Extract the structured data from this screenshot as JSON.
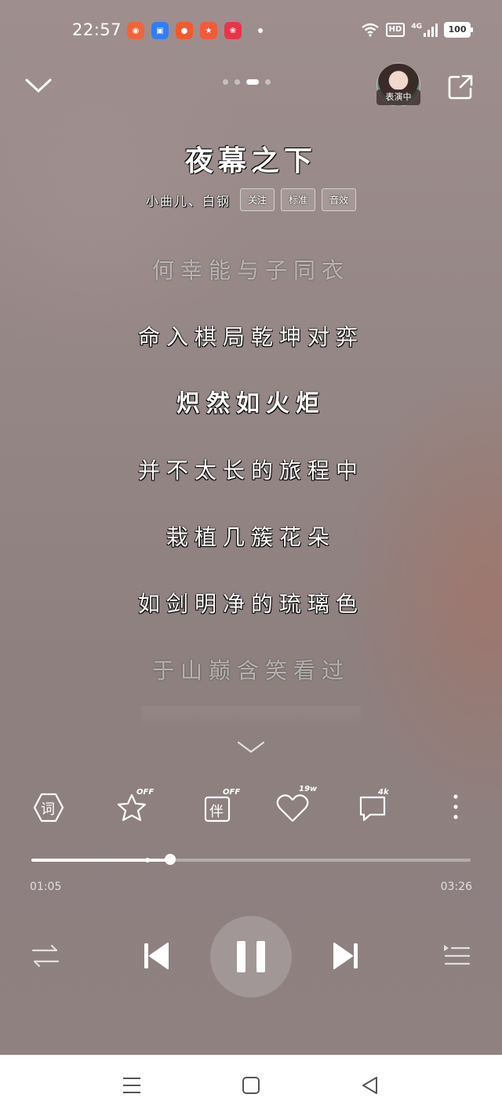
{
  "status_bar": {
    "time": "22:57",
    "app_icons": [
      {
        "name": "app-icon-1",
        "color": "#f0643a"
      },
      {
        "name": "app-icon-2",
        "color": "#2f7ef5"
      },
      {
        "name": "app-icon-3",
        "color": "#f25a2c"
      },
      {
        "name": "app-icon-4",
        "color": "#f15a3a"
      },
      {
        "name": "app-icon-5",
        "color": "#e8344a"
      }
    ],
    "hd_label": "HD",
    "network_label": "4G",
    "battery_level": "100"
  },
  "header": {
    "page_count": 4,
    "active_page": 3,
    "avatar_tag": "表演中"
  },
  "song": {
    "title": "夜幕之下",
    "artists": "小曲儿、白钢",
    "tags": [
      "关注",
      "标准",
      "音效"
    ]
  },
  "lyrics": [
    {
      "text": "何幸能与子同衣",
      "state": "dim"
    },
    {
      "text": "命入棋局乾坤对弈",
      "state": "normal"
    },
    {
      "text": "炽然如火炬",
      "state": "current"
    },
    {
      "text": "并不太长的旅程中",
      "state": "normal"
    },
    {
      "text": "栽植几簇花朵",
      "state": "normal"
    },
    {
      "text": "如剑明净的琉璃色",
      "state": "normal"
    },
    {
      "text": "于山巅含笑看过",
      "state": "dim"
    }
  ],
  "actions": {
    "lyrics_btn_label": "词",
    "star_badge": "OFF",
    "accompany_label": "伴",
    "accompany_badge": "OFF",
    "like_count": "19w",
    "comment_count": "4k"
  },
  "player": {
    "current_time": "01:05",
    "total_time": "03:26",
    "progress": 0.316,
    "buffered": 0.264
  },
  "colors": {
    "accent": "#ffffff",
    "nav_bg": "#ffffff"
  }
}
